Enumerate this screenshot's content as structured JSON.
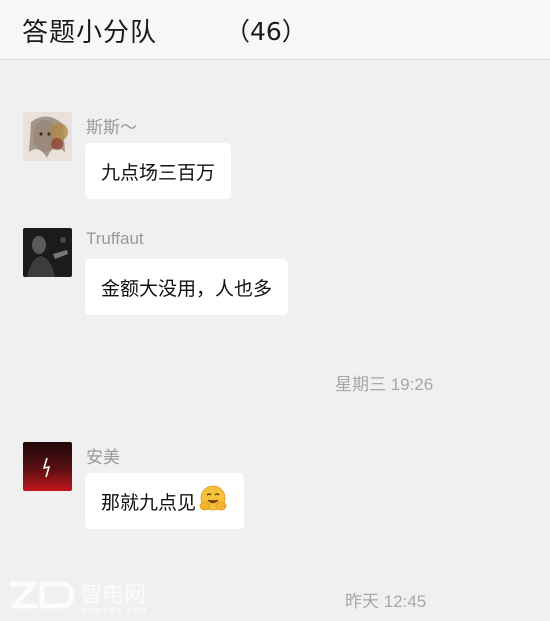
{
  "header": {
    "title": "答题小分队",
    "member_count": "（46）"
  },
  "messages": [
    {
      "sender": "斯斯～",
      "text": "九点场三百万"
    },
    {
      "sender": "Truffaut",
      "text": "金额大没用，人也多"
    },
    {
      "sender": "安美",
      "text": "那就九点见",
      "emoji": "hug-emoji"
    }
  ],
  "timestamps": [
    "星期三 19:26",
    "昨天 12:45"
  ],
  "watermark": {
    "brand": "智电网",
    "sub": "ZDWANG.COM"
  }
}
